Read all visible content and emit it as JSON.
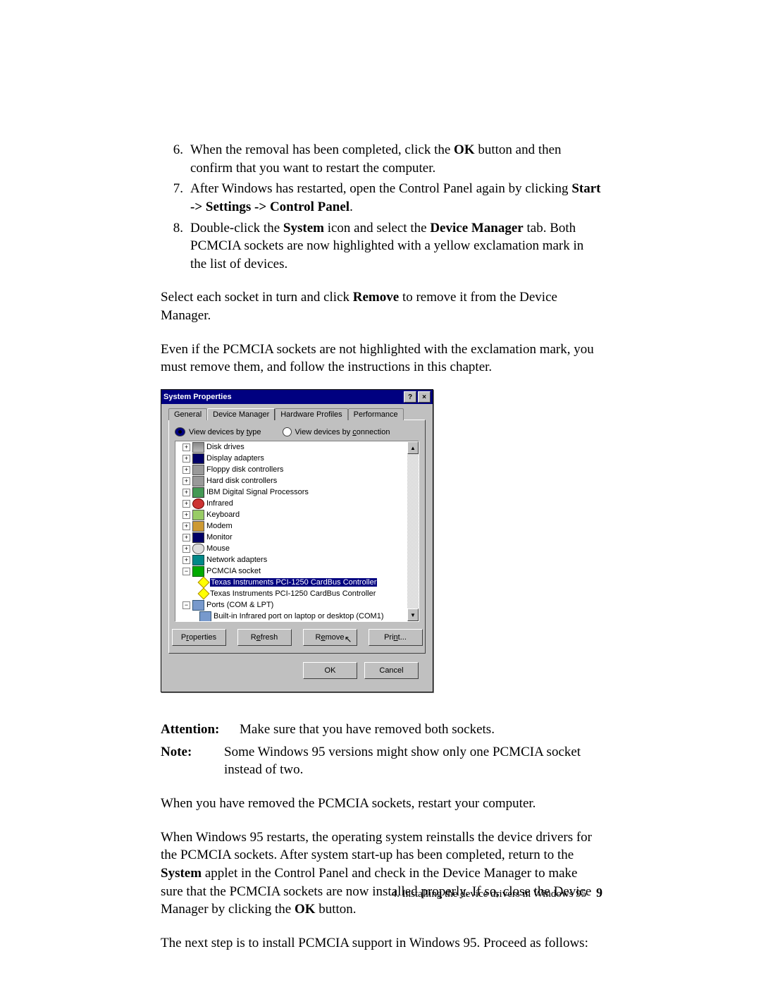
{
  "list": {
    "n6": "6.",
    "t6a": "When the removal has been completed, click the ",
    "t6b": "OK",
    "t6c": " button and then confirm that you want to restart the computer.",
    "n7": "7.",
    "t7a": "After Windows has restarted, open the Control Panel again by clicking ",
    "t7b": "Start  -> Settings -> Control Panel",
    "t7c": ".",
    "n8": "8.",
    "t8a": "Double-click the ",
    "t8b": "System",
    "t8c": " icon and select the ",
    "t8d": "Device Manager",
    "t8e": " tab. Both PCMCIA sockets are now highlighted with a yellow exclamation mark in the list of devices."
  },
  "p1a": "Select each socket in turn and click ",
  "p1b": "Remove",
  "p1c": " to remove it from the Device Manager.",
  "p2": "Even if the PCMCIA sockets are not highlighted with the exclamation mark, you must remove them, and follow the instructions in this chapter.",
  "dialog": {
    "title": "System Properties",
    "tabs": {
      "general": "General",
      "dm": "Device Manager",
      "hp": "Hardware Profiles",
      "perf": "Performance"
    },
    "radio1a": "View devices by ",
    "radio1b": "t",
    "radio1c": "ype",
    "radio2a": "View devices by ",
    "radio2b": "c",
    "radio2c": "onnection",
    "tree": {
      "disk": "Disk drives",
      "disp": "Display adapters",
      "floppy": "Floppy disk controllers",
      "hdd": "Hard disk controllers",
      "ibm": "IBM Digital Signal Processors",
      "ir": "Infrared",
      "kb": "Keyboard",
      "modem": "Modem",
      "mon": "Monitor",
      "mouse": "Mouse",
      "net": "Network adapters",
      "pcmcia": "PCMCIA socket",
      "ti1": "Texas Instruments PCI-1250 CardBus Controller",
      "ti2": "Texas Instruments PCI-1250 CardBus Controller",
      "ports": "Ports (COM & LPT)",
      "irport": "Built-in Infrared port on laptop or desktop (COM1)"
    },
    "btn": {
      "prop": "Properties",
      "propU": "r",
      "refresh": "Refresh",
      "refreshU": "e",
      "remove": "Remove",
      "removeU": "R",
      "print": "Print...",
      "printU": "n",
      "ok": "OK",
      "cancel": "Cancel"
    }
  },
  "attn": {
    "lbl": "Attention:",
    "txt": "Make sure that you have removed both sockets."
  },
  "note": {
    "lbl": "Note:",
    "txt": "Some Windows 95 versions might show only one PCMCIA socket instead of two."
  },
  "p3": "When you have removed the PCMCIA sockets, restart your computer.",
  "p4a": "When Windows 95 restarts, the operating system reinstalls the device drivers for the PCMCIA sockets. After system start-up has been completed, return to the ",
  "p4b": "System",
  "p4c": " applet in the Control Panel and check in the Device Manager to make sure that the PCMCIA sockets are now installed properly. If so, close the Device Manager by clicking the ",
  "p4d": "OK",
  "p4e": " button.",
  "p5": "The next step is to install PCMCIA support in Windows 95. Proceed as follows:",
  "footer": {
    "chap": "4.  Installing the device drivers in Windows 95",
    "page": "9"
  }
}
